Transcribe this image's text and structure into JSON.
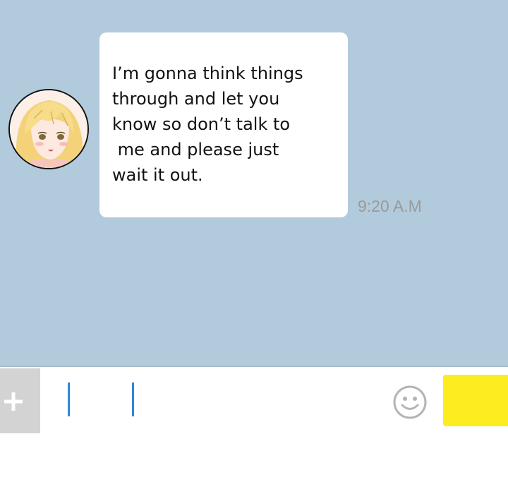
{
  "conversation": {
    "message": {
      "lines": [
        "I’m gonna think things",
        "through and let you",
        "know so don’t talk to",
        " me and please just",
        "wait it out."
      ],
      "timestamp": "9:20 A.M"
    }
  },
  "input_bar": {
    "plus_icon": "plus-icon",
    "emoji_icon": "smiley-icon",
    "send_color": "#fdec1f"
  },
  "colors": {
    "chat_background": "#b2cbdc",
    "bubble": "#ffffff",
    "caret": "#2a8ad8",
    "timestamp": "#9a9a9a"
  }
}
